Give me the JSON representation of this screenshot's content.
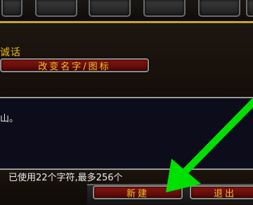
{
  "dialog": {
    "message_label": "诚话",
    "rename_button": "改变名字/图标",
    "message_text": "山。",
    "char_count": "已使用22个字符,最多256个",
    "new_button": "新建",
    "exit_button": "退出"
  },
  "colors": {
    "gold_text": "#f0c228",
    "button_red": "#8a1510",
    "pointer_arrow": "#00e000"
  }
}
